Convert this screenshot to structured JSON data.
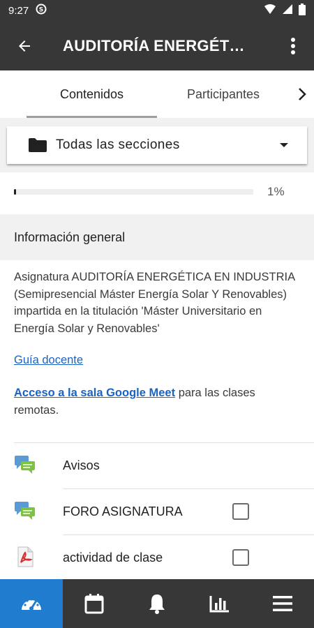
{
  "status": {
    "time": "9:27"
  },
  "appbar": {
    "title": "AUDITORÍA ENERGÉT…"
  },
  "tabs": [
    {
      "label": "Contenidos"
    },
    {
      "label": "Participantes"
    }
  ],
  "sections": {
    "selected": "Todas las secciones"
  },
  "progress": {
    "value": 1,
    "label": "1%"
  },
  "general": {
    "heading": "Información general",
    "summary": "Asignatura AUDITORÍA ENERGÉTICA EN INDUSTRIA (Semipresencial Máster Energía Solar Y Renovables) impartida en la titulación 'Máster Universitario en Energía Solar y Renovables'",
    "guide_link": "Guía docente",
    "meet_link": "Acceso a la sala Google Meet",
    "meet_text": " para las clases remotas."
  },
  "modules": [
    {
      "name": "Avisos",
      "icon": "forum-icon",
      "checkbox": false
    },
    {
      "name": "FORO ASIGNATURA",
      "icon": "forum-icon",
      "checkbox": true
    },
    {
      "name": "actividad de clase",
      "icon": "pdf-icon",
      "checkbox": true
    }
  ],
  "bottom_nav": [
    {
      "icon": "dashboard-icon",
      "active": true
    },
    {
      "icon": "calendar-icon",
      "active": false
    },
    {
      "icon": "bell-icon",
      "active": false
    },
    {
      "icon": "grades-icon",
      "active": false
    },
    {
      "icon": "menu-icon",
      "active": false
    }
  ],
  "colors": {
    "bar": "#373737",
    "accent": "#1f7ccf",
    "link": "#1a63c5"
  }
}
